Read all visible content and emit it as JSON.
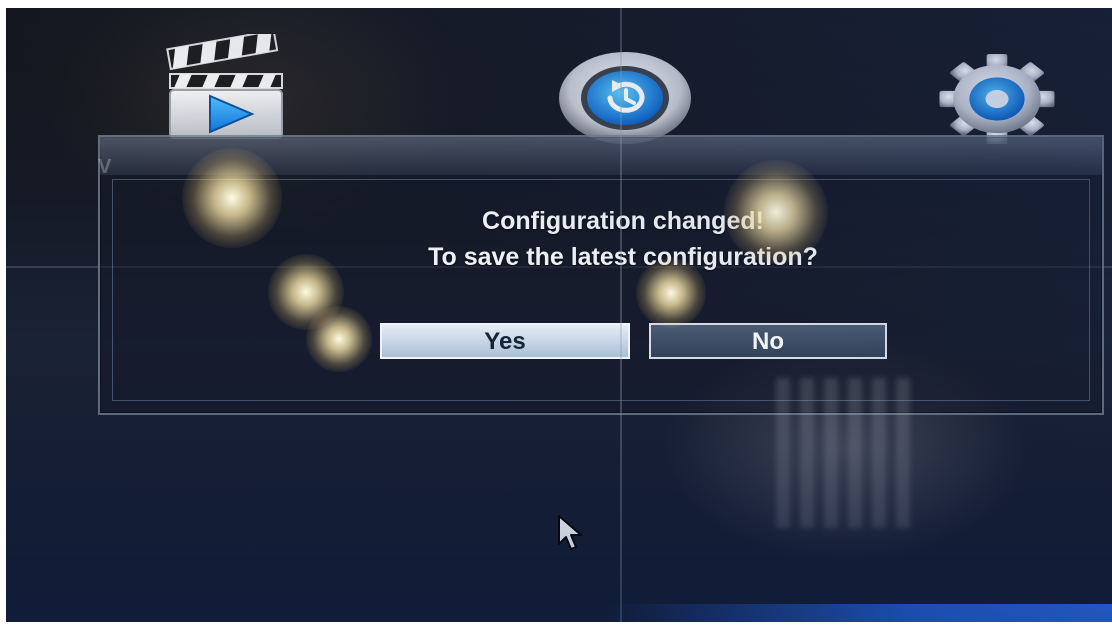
{
  "menu": {
    "items": [
      {
        "icon": "video-clapperboard-icon",
        "label_partial": "V"
      },
      {
        "icon": "backup-restore-icon"
      },
      {
        "icon": "gear-icon"
      }
    ]
  },
  "dialog": {
    "message_line1": "Configuration changed!",
    "message_line2": "To save the latest configuration?",
    "yes_label": "Yes",
    "no_label": "No"
  },
  "colors": {
    "background": "#161a26",
    "dialog_border": "#96a5b9",
    "yes_button": "#c4d4e6",
    "no_button": "#33415a",
    "accent_blue": "#2a8ff0"
  },
  "cursor": {
    "icon": "mouse-pointer-icon"
  }
}
